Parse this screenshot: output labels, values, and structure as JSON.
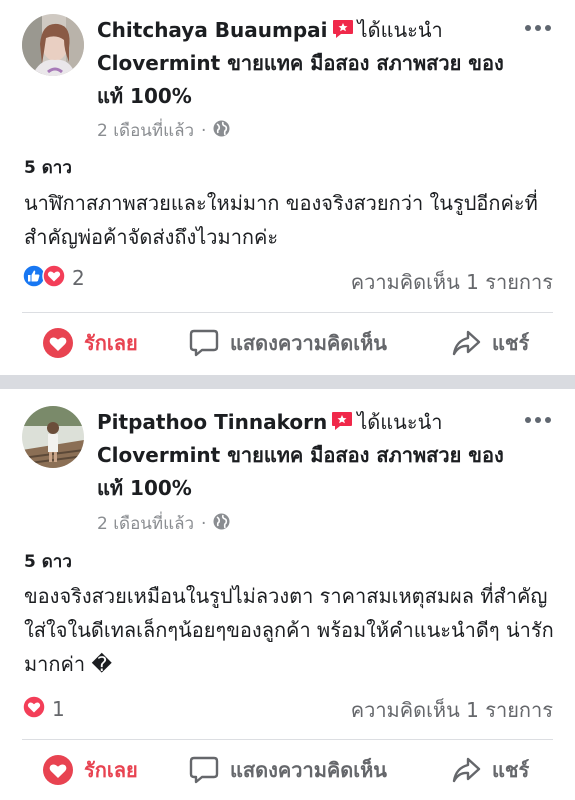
{
  "posts": [
    {
      "author": "Chitchaya Buaumpai",
      "verb": "ได้แนะนำ",
      "page": "Clovermint ขายแทค มือสอง สภาพสวย ของแท้ 100%",
      "time": "2 เดือนที่แล้ว",
      "rating": "5 ดาว",
      "text": "นาฬิกาสภาพสวยและใหม่มาก ของจริงสวยกว่า ในรูปอีกค่ะที่สำคัญพ่อค้าจัดส่งถึงไวมากค่ะ",
      "reaction_count": "2",
      "comments": "ความคิดเห็น 1 รายการ"
    },
    {
      "author": "Pitpathoo Tinnakorn",
      "verb": "ได้แนะนำ",
      "page": "Clovermint ขายแทค มือสอง สภาพสวย ของแท้ 100%",
      "time": "2 เดือนที่แล้ว",
      "rating": "5 ดาว",
      "text": "ของจริงสวยเหมือนในรูปไม่ลวงตา ราคาสมเหตุสมผล ที่สำคัญใส่ใจในดีเทลเล็กๆน้อยๆของลูกค้า พร้อมให้คำแนะนำดีๆ น่ารักมากค่า �",
      "reaction_count": "1",
      "comments": "ความคิดเห็น 1 รายการ"
    }
  ],
  "actions": {
    "love": "รักเลย",
    "comment": "แสดงความคิดเห็น",
    "share": "แชร์"
  },
  "icons": [
    "recommend-badge-icon",
    "more-icon",
    "globe-icon",
    "like-reaction-icon",
    "love-reaction-icon",
    "heart-outline-icon",
    "comment-icon",
    "share-icon"
  ],
  "colors": {
    "love": "#e84351",
    "like": "#1877f2",
    "muted": "#65676b",
    "separator": "#d9dbe0"
  }
}
